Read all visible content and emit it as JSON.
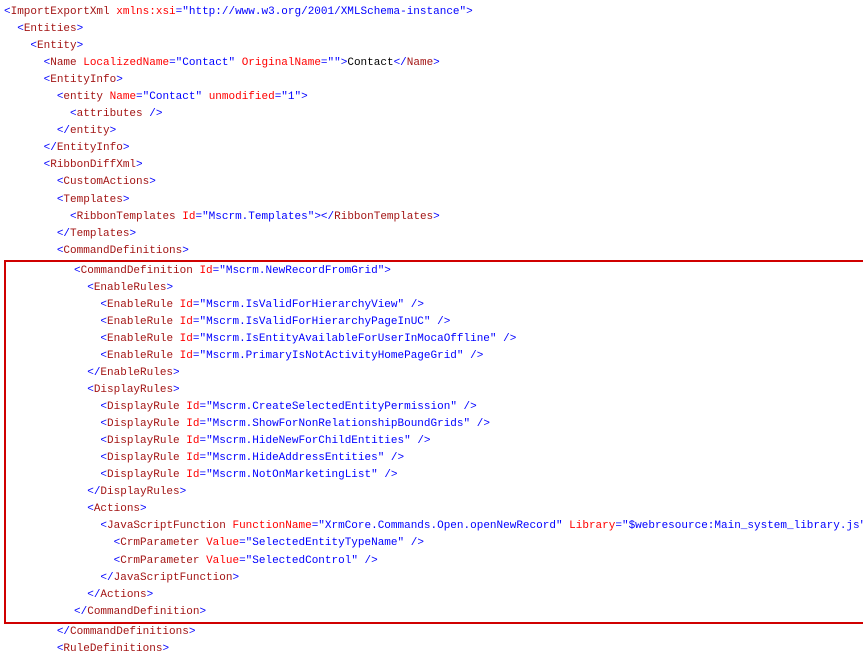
{
  "root": {
    "tag": "ImportExportXml",
    "attr_xmlns_xsi": "xmlns:xsi",
    "val_xmlns_xsi": "http://www.w3.org/2001/XMLSchema-instance"
  },
  "entities_tag": "Entities",
  "entity_tag": "Entity",
  "name": {
    "tag": "Name",
    "attr_localized": "LocalizedName",
    "val_localized": "Contact",
    "attr_original": "OriginalName",
    "val_original": "",
    "text": "Contact"
  },
  "entityinfo_tag": "EntityInfo",
  "entity_lc": {
    "tag": "entity",
    "attr_name": "Name",
    "val_name": "Contact",
    "attr_unmodified": "unmodified",
    "val_unmodified": "1"
  },
  "attributes_tag": "attributes",
  "ribbondiff_tag": "RibbonDiffXml",
  "customactions_tag": "CustomActions",
  "templates_tag": "Templates",
  "ribbontemplates": {
    "tag": "RibbonTemplates",
    "attr_id": "Id",
    "val_id": "Mscrm.Templates"
  },
  "commanddefs_tag": "CommandDefinitions",
  "commanddef": {
    "tag": "CommandDefinition",
    "attr_id": "Id",
    "val_id": "Mscrm.NewRecordFromGrid"
  },
  "enablerules_tag": "EnableRules",
  "enablerule_tag": "EnableRule",
  "id_attr": "Id",
  "enable_ids": [
    "Mscrm.IsValidForHierarchyView",
    "Mscrm.IsValidForHierarchyPageInUC",
    "Mscrm.IsEntityAvailableForUserInMocaOffline",
    "Mscrm.PrimaryIsNotActivityHomePageGrid"
  ],
  "displayrules_tag": "DisplayRules",
  "displayrule_tag": "DisplayRule",
  "display_ids": [
    "Mscrm.CreateSelectedEntityPermission",
    "Mscrm.ShowForNonRelationshipBoundGrids",
    "Mscrm.HideNewForChildEntities",
    "Mscrm.HideAddressEntities",
    "Mscrm.NotOnMarketingList"
  ],
  "actions_tag": "Actions",
  "jsfunc": {
    "tag": "JavaScriptFunction",
    "attr_func": "FunctionName",
    "val_func": "XrmCore.Commands.Open.openNewRecord",
    "attr_lib": "Library",
    "val_lib": "$webresource:Main_system_library.js"
  },
  "crmparam_tag": "CrmParameter",
  "value_attr": "Value",
  "crm_values": [
    "SelectedEntityTypeName",
    "SelectedControl"
  ],
  "ruledefs_tag": "RuleDefinitions",
  "indent": "  "
}
